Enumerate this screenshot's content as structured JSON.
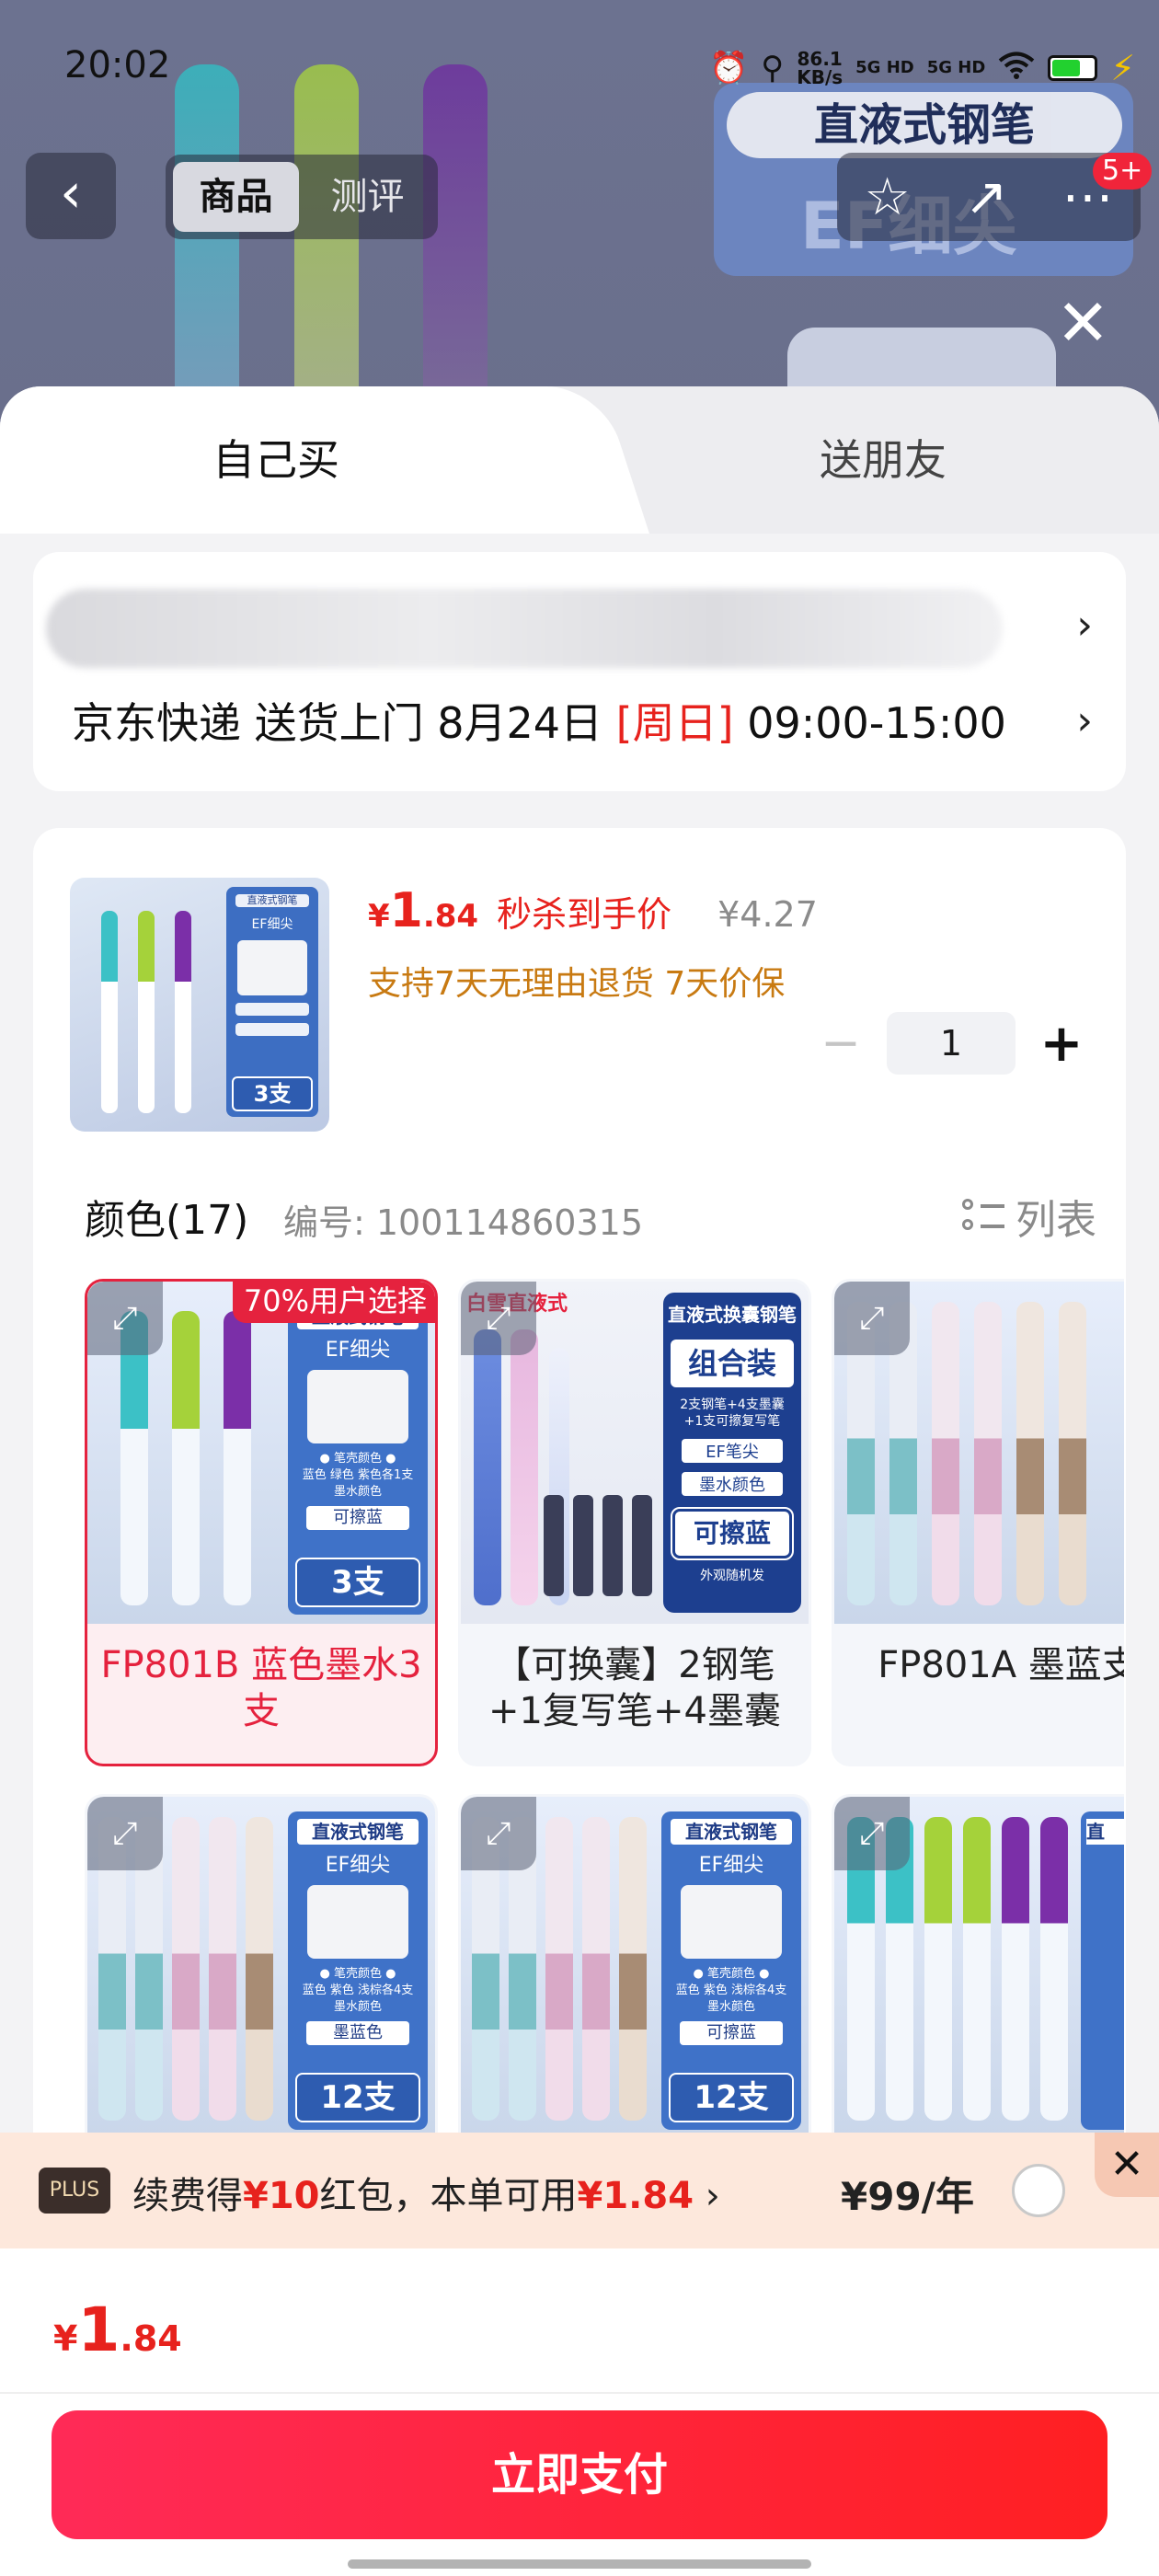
{
  "status_bar": {
    "time": "20:02",
    "speed": "86.1",
    "speed_unit": "KB/s",
    "net1": "5G HD",
    "net2": "5G HD",
    "icons": [
      "alarm-icon",
      "location-icon",
      "wifi-icon",
      "battery-icon",
      "charging-icon"
    ]
  },
  "background": {
    "banner_title": "直液式钢笔",
    "banner_sub": "EF细尖",
    "nav_tabs": [
      "商品",
      "测评"
    ],
    "badge": "5+"
  },
  "sheet": {
    "tabs": {
      "self": "自己买",
      "friend": "送朋友"
    },
    "delivery": {
      "carrier": "京东快递 送货上门 8月24日 ",
      "day": "[周日]",
      "window": " 09:00-15:00"
    },
    "product": {
      "price_symbol": "¥",
      "price_int": "1",
      "price_dec": ".84",
      "price_tag": "秒杀到手价",
      "orig_price": "¥4.27",
      "policy": "支持7天无理由退货  7天价保",
      "quantity": "1",
      "thumb_box": {
        "title": "直液式钢笔",
        "sub": "EF细尖",
        "qty": "3支"
      }
    },
    "variants": {
      "title": "颜色(17)",
      "code": "编号: 100114860315",
      "list_label": "列表",
      "selected_badge": "70%用户选择",
      "items": [
        {
          "label": "FP801B 蓝色墨水3支",
          "box_title": "直液式钢笔",
          "box_ef": "EF细尖",
          "box_small1": "● 笔壳颜色 ●",
          "box_small2": "蓝色 绿色 紫色各1支",
          "box_small3": "墨水颜色",
          "box_tag": "可擦蓝",
          "box_qty": "3支"
        },
        {
          "label": "【可换囊】2钢笔+1复写笔+4墨囊",
          "tag": "白雪直液式",
          "c1": "直液式换囊钢笔",
          "c2": "组合装",
          "c3": "2支钢笔+4支墨囊 +1支可擦复写笔",
          "c4": "EF笔尖",
          "c5": "墨水颜色",
          "c6": "可擦蓝",
          "c7": "外观随机发"
        },
        {
          "label": "FP801A 墨蓝支"
        },
        {
          "box_title": "直液式钢笔",
          "box_ef": "EF细尖",
          "box_small1": "● 笔壳颜色 ●",
          "box_small2": "蓝色 紫色 浅棕各4支",
          "box_small3": "墨水颜色",
          "box_tag": "墨蓝色",
          "box_qty": "12支"
        },
        {
          "box_title": "直液式钢笔",
          "box_ef": "EF细尖",
          "box_small1": "● 笔壳颜色 ●",
          "box_small2": "蓝色 紫色 浅棕各4支",
          "box_small3": "墨水颜色",
          "box_tag": "可擦蓝",
          "box_qty": "12支"
        },
        {
          "box_title": "直"
        }
      ]
    }
  },
  "plus_bar": {
    "logo": "PLUS",
    "text_a": "续费得",
    "text_b": "¥10",
    "text_c": "红包，本单可用",
    "text_d": "¥1.84",
    "text_e": " ›",
    "price": "¥99/年",
    "close": "✕"
  },
  "footer": {
    "price_symbol": "¥",
    "price_int": "1",
    "price_dec": ".84",
    "pay_label": "立即支付"
  },
  "colors": {
    "accent_red": "#e7221d",
    "pay_gradient_start": "#ff2a57",
    "policy_orange": "#c87a12",
    "plus_bg": "#fde8dc"
  }
}
